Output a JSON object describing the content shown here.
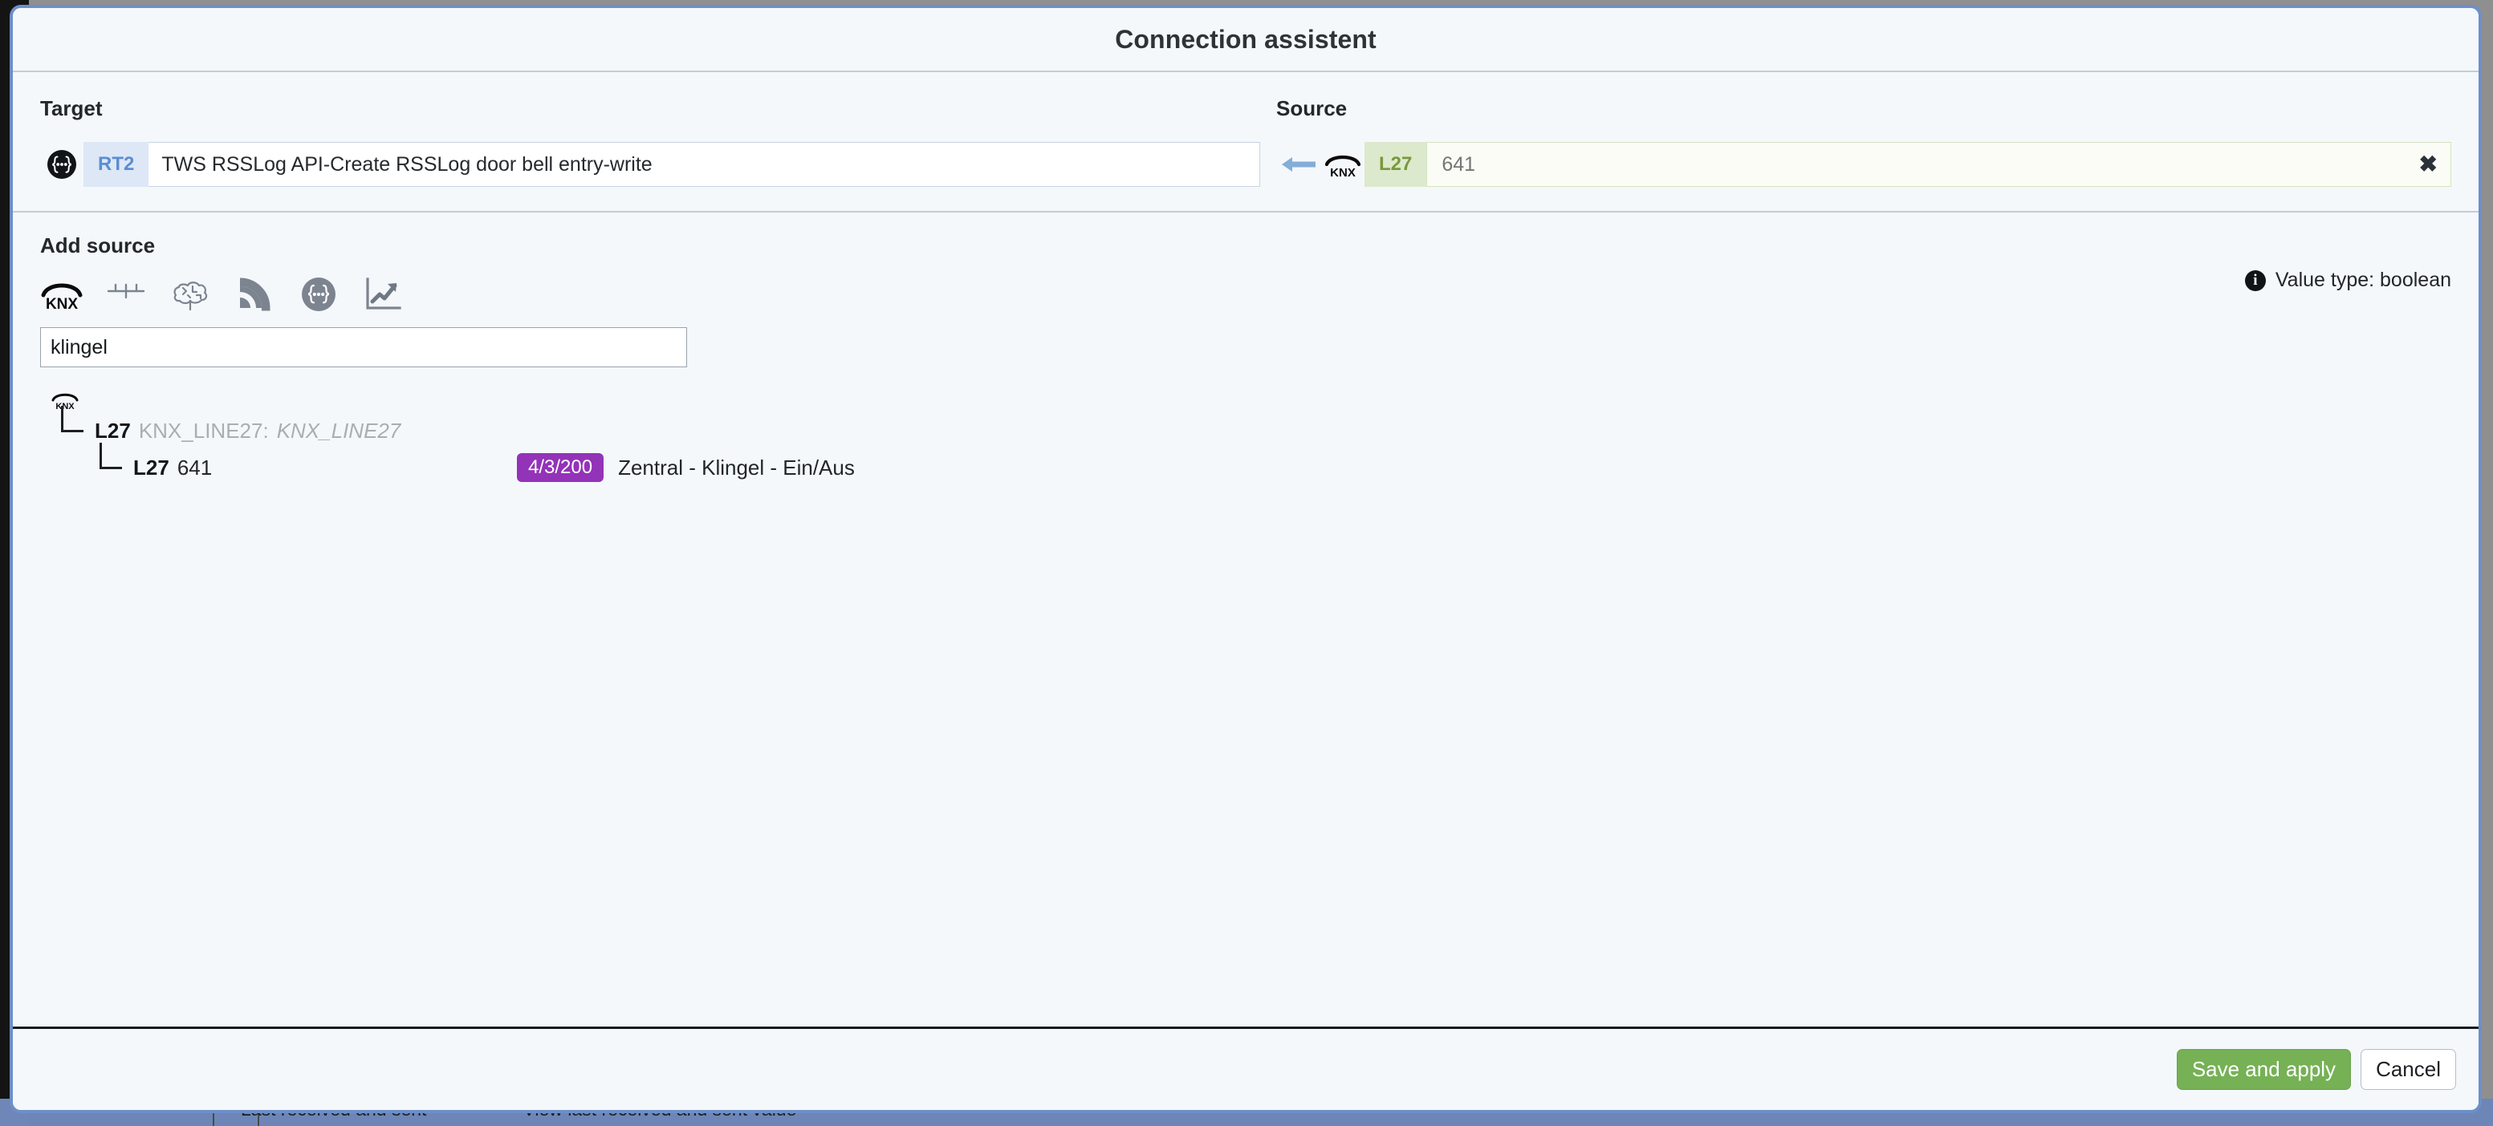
{
  "modal": {
    "title": "Connection assistent"
  },
  "target": {
    "heading": "Target",
    "icon": "json-braces-circle-icon",
    "tag": "RT2",
    "value": "TWS RSSLog API-Create RSSLog door bell entry-write"
  },
  "source": {
    "heading": "Source",
    "arrow_icon": "arrow-left-icon",
    "icon": "knx-logo-icon",
    "tag": "L27",
    "placeholder": "641",
    "value": "",
    "clear_label": "✖"
  },
  "add_source": {
    "heading": "Add source",
    "type_icons": [
      {
        "name": "knx-logo-icon",
        "label": "KNX"
      },
      {
        "name": "logic-wire-icon",
        "label": "Logic"
      },
      {
        "name": "brain-icon",
        "label": "Brain"
      },
      {
        "name": "rss-signal-icon",
        "label": "RSS"
      },
      {
        "name": "json-braces-circle-icon",
        "label": "JSON"
      },
      {
        "name": "chart-trend-icon",
        "label": "Chart"
      }
    ],
    "search_value": "klingel",
    "search_placeholder": "",
    "value_type_note": "Value type: boolean",
    "info_icon": "info-icon"
  },
  "results": {
    "root_icon": "knx-logo-icon",
    "line": {
      "id": "L27",
      "name": "KNX_LINE27:",
      "alias": "KNX_LINE27"
    },
    "items": [
      {
        "id": "L27",
        "value": "641",
        "group_address": "4/3/200",
        "description": "Zentral - Klingel - Ein/Aus"
      }
    ]
  },
  "footer": {
    "save_label": "Save and apply",
    "cancel_label": "Cancel"
  },
  "background": {
    "strip_items": [
      "Last received and sent",
      "View last received and sent value"
    ]
  },
  "colors": {
    "accent_blue": "#6d8fc9",
    "target_tag": "#5b8ed2",
    "target_tag_bg": "#dde7f6",
    "source_tag": "#79993b",
    "source_tag_bg": "#dde9cc",
    "group_address_badge": "#9333b8",
    "save_button": "#76b155",
    "modal_bg": "#f4f8fb"
  }
}
